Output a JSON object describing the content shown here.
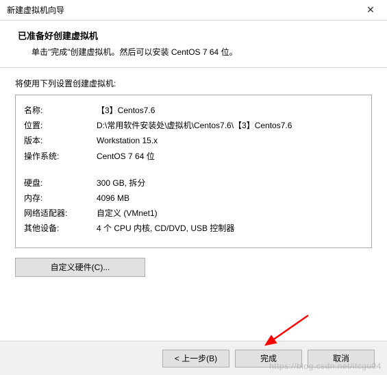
{
  "titlebar": {
    "title": "新建虚拟机向导"
  },
  "header": {
    "title": "已准备好创建虚拟机",
    "subtitle": "单击\"完成\"创建虚拟机。然后可以安装 CentOS 7 64 位。"
  },
  "content": {
    "caption": "将使用下列设置创建虚拟机:",
    "rows": [
      {
        "label": "名称:",
        "value": "【3】Centos7.6"
      },
      {
        "label": "位置:",
        "value": "D:\\常用软件安装处\\虚拟机\\Centos7.6\\【3】Centos7.6"
      },
      {
        "label": "版本:",
        "value": "Workstation 15.x"
      },
      {
        "label": "操作系统:",
        "value": "CentOS 7 64 位"
      }
    ],
    "rows2": [
      {
        "label": "硬盘:",
        "value": "300 GB, 拆分"
      },
      {
        "label": "内存:",
        "value": "4096 MB"
      },
      {
        "label": "网络适配器:",
        "value": "自定义 (VMnet1)"
      },
      {
        "label": "其他设备:",
        "value": "4 个 CPU 内核, CD/DVD, USB 控制器"
      }
    ],
    "customize_label": "自定义硬件(C)..."
  },
  "footer": {
    "back": "< 上一步(B)",
    "finish": "完成",
    "cancel": "取消"
  },
  "watermark": "https://blog.csdn.net/itcgu04"
}
